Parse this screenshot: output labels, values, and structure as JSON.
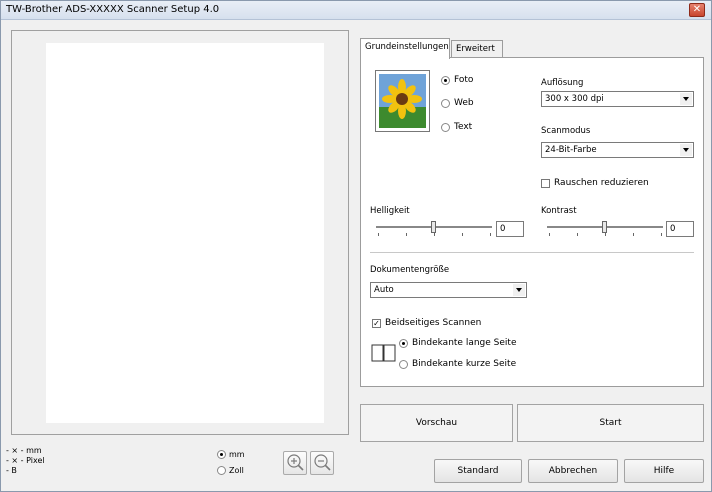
{
  "window": {
    "title": "TW-Brother ADS-XXXXX Scanner Setup 4.0",
    "close": "✕"
  },
  "status": {
    "x_mm": "- × - mm",
    "x_pixel": "- × - Pixel",
    "b": "- B"
  },
  "units": {
    "mm": "mm",
    "zoll": "Zoll",
    "selected": "mm"
  },
  "zoom": {
    "in": "zoom-in",
    "out": "zoom-out"
  },
  "tabs": [
    {
      "label": "Grundeinstellungen",
      "active": true
    },
    {
      "label": "Erweitert",
      "active": false
    }
  ],
  "image_type": {
    "options": [
      "Foto",
      "Web",
      "Text"
    ],
    "selected": "Foto"
  },
  "aufloesung": {
    "label": "Auflösung",
    "value": "300 x 300 dpi"
  },
  "scanmodus": {
    "label": "Scanmodus",
    "value": "24-Bit-Farbe"
  },
  "rauschen": {
    "label": "Rauschen reduzieren",
    "checked": false
  },
  "helligkeit": {
    "label": "Helligkeit",
    "value": "0"
  },
  "kontrast": {
    "label": "Kontrast",
    "value": "0"
  },
  "dokument": {
    "label": "Dokumentengröße",
    "value": "Auto"
  },
  "duplex": {
    "label": "Beidseitiges Scannen",
    "checked": true,
    "options": [
      "Bindekante lange Seite",
      "Bindekante kurze Seite"
    ],
    "selected": "Bindekante lange Seite"
  },
  "actions": {
    "vorschau": "Vorschau",
    "start": "Start"
  },
  "footer": {
    "standard": "Standard",
    "abbrechen": "Abbrechen",
    "hilfe": "Hilfe"
  }
}
